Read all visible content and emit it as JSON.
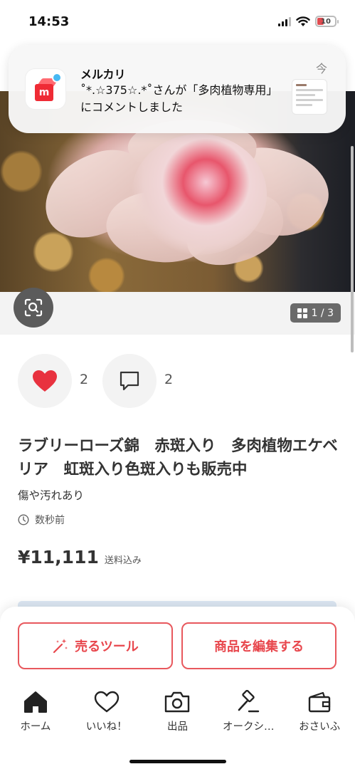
{
  "status_bar": {
    "time": "14:53",
    "battery": "10"
  },
  "notification": {
    "app_name": "メルカリ",
    "message": "˚*.☆375☆.*˚さんが「多肉植物専用」にコメントしました",
    "time": "今"
  },
  "image": {
    "counter": "1 / 3"
  },
  "social": {
    "likes": "2",
    "comments": "2"
  },
  "product": {
    "title": "ラブリーローズ錦　赤斑入り　多肉植物エケベリア　虹斑入り色斑入りも販売中",
    "condition": "傷や汚れあり",
    "posted": "数秒前",
    "price": "¥11,111",
    "shipping": "送料込み"
  },
  "actions": {
    "sell_tool": "売るツール",
    "edit": "商品を編集する"
  },
  "tabs": [
    {
      "label": "ホーム",
      "icon": "home-icon"
    },
    {
      "label": "いいね！",
      "icon": "heart-outline-icon"
    },
    {
      "label": "出品",
      "icon": "camera-icon"
    },
    {
      "label": "オークシ…",
      "icon": "auction-hammer-icon"
    },
    {
      "label": "おさいふ",
      "icon": "wallet-icon"
    }
  ],
  "colors": {
    "accent": "#e8474d",
    "like": "#e8323f",
    "notification_dot": "#47b9f3"
  }
}
